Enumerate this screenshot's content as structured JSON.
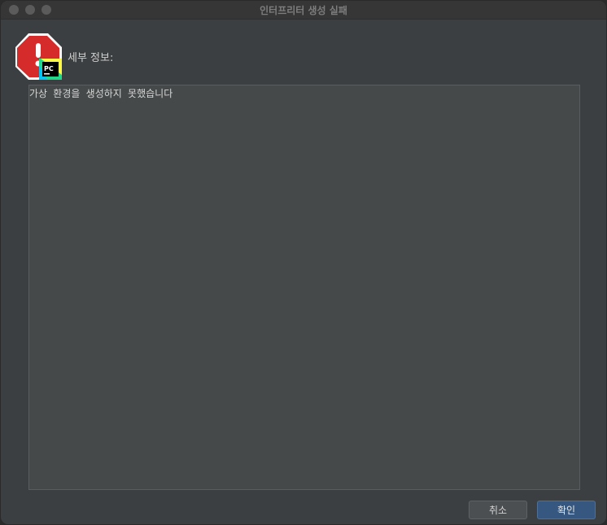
{
  "window": {
    "title": "인터프리터 생성 실패"
  },
  "icons": {
    "error": "error-stop-icon",
    "app_badge": "pycharm-icon",
    "app_badge_text": "PC"
  },
  "content": {
    "details_label": "세부 정보:",
    "details_text": "가상 환경을 생성하지 못했습니다"
  },
  "buttons": {
    "cancel_label": "취소",
    "ok_label": "확인"
  },
  "colors": {
    "accent": "#365880",
    "error": "#d62b2b"
  }
}
